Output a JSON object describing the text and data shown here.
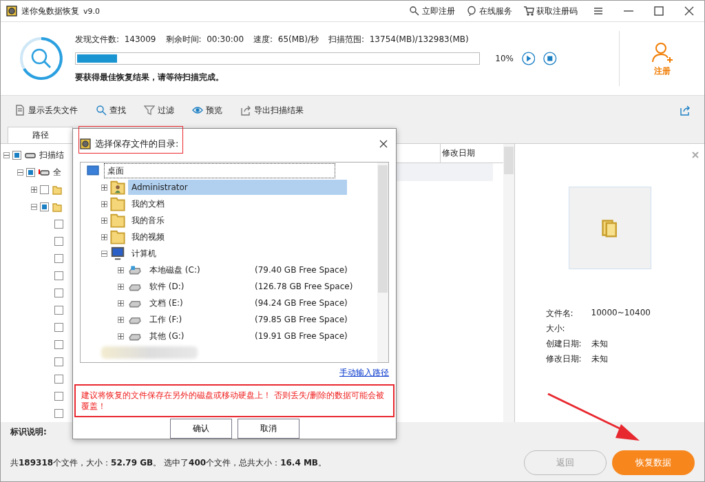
{
  "window": {
    "title": "迷你兔数据恢复",
    "version": "v9.0",
    "actions": [
      "立即注册",
      "在线服务",
      "获取注册码"
    ]
  },
  "scan": {
    "stats": [
      {
        "label": "发现文件数:",
        "value": "143009"
      },
      {
        "label": "剩余时间:",
        "value": "00:30:00"
      },
      {
        "label": "速度:",
        "value": "65(MB)/秒"
      },
      {
        "label": "扫描范围:",
        "value": "13754(MB)/132983(MB)"
      }
    ],
    "level": 0.1,
    "percent": "10%",
    "message": "要获得最佳恢复结果，请等待扫描完成。"
  },
  "register": {
    "label": "注册"
  },
  "toolbar": [
    "显示丢失文件",
    "查找",
    "过滤",
    "预览",
    "导出扫描结果"
  ],
  "tabs": [
    {
      "label": "路径",
      "selected": true
    }
  ],
  "tree": [
    {
      "label": "扫描结",
      "checked": true,
      "expanded": true,
      "kind": "disk",
      "children": [
        {
          "label": "全",
          "checked": true,
          "expanded": true,
          "kind": "lost-disk",
          "children": [
            {
              "checked": false,
              "expanded": false,
              "kind": "folder"
            },
            {
              "checked": true,
              "expanded": true,
              "kind": "folder",
              "children": [
                {
                  "checked": false
                },
                {
                  "checked": false
                },
                {
                  "checked": false
                },
                {
                  "checked": false
                },
                {
                  "checked": false
                },
                {
                  "checked": false
                },
                {
                  "checked": false
                },
                {
                  "checked": false
                },
                {
                  "checked": false
                },
                {
                  "checked": false
                },
                {
                  "checked": false
                },
                {
                  "checked": false
                }
              ]
            }
          ]
        }
      ]
    }
  ],
  "table": {
    "columns": [
      "修改日期"
    ]
  },
  "preview": {
    "fields": [
      {
        "label": "文件名:",
        "value": "10000~10400"
      },
      {
        "label": "大小:"
      },
      {
        "label": "创建日期:",
        "value": "未知"
      },
      {
        "label": "修改日期:",
        "value": "未知"
      }
    ]
  },
  "legend": {
    "label": "标识说明:"
  },
  "summary": "共**189318**个文件，大小：**52.79 GB**。 选中了**400**个文件，总共大小：**16.4 MB**。",
  "buttons": [
    {
      "label": "返回",
      "kind": "secondary",
      "disabled": true
    },
    {
      "label": "恢复数据",
      "kind": "primary",
      "disabled": false
    }
  ],
  "dialog": {
    "title": "选择保存文件的目录:",
    "tree": [
      {
        "label": "桌面",
        "kind": "desktop",
        "selected": false,
        "children": [
          {
            "label": "Administrator",
            "kind": "user-folder",
            "expanded": false,
            "selected": true
          },
          {
            "label": "我的文档",
            "kind": "folder",
            "expanded": false,
            "selected": false
          },
          {
            "label": "我的音乐",
            "kind": "folder",
            "expanded": false,
            "selected": false
          },
          {
            "label": "我的视频",
            "kind": "folder",
            "expanded": false,
            "selected": false
          },
          {
            "label": "计算机",
            "kind": "computer",
            "expanded": true,
            "selected": false,
            "children": [
              {
                "label": "本地磁盘 (C:)",
                "free": "(79.40 GB Free Space)",
                "kind": "system-drive",
                "expanded": false,
                "selected": false
              },
              {
                "label": "软件 (D:)",
                "free": "(126.78 GB Free Space)",
                "kind": "drive",
                "expanded": false,
                "selected": false
              },
              {
                "label": "文档 (E:)",
                "free": "(94.24 GB Free Space)",
                "kind": "drive",
                "expanded": false,
                "selected": false
              },
              {
                "label": "工作 (F:)",
                "free": "(79.85 GB Free Space)",
                "kind": "drive",
                "expanded": false,
                "selected": false
              },
              {
                "label": "其他 (G:)",
                "free": "(19.91 GB Free Space)",
                "kind": "drive",
                "expanded": false,
                "selected": false
              }
            ]
          },
          {
            "kind": "blurred"
          }
        ]
      }
    ],
    "link": "手动输入路径",
    "warning": "建议将恢复的文件保存在另外的磁盘或移动硬盘上！ 否则丢失/删除的数据可能会被覆盖！",
    "buttons": [
      "确认",
      "取消"
    ]
  }
}
